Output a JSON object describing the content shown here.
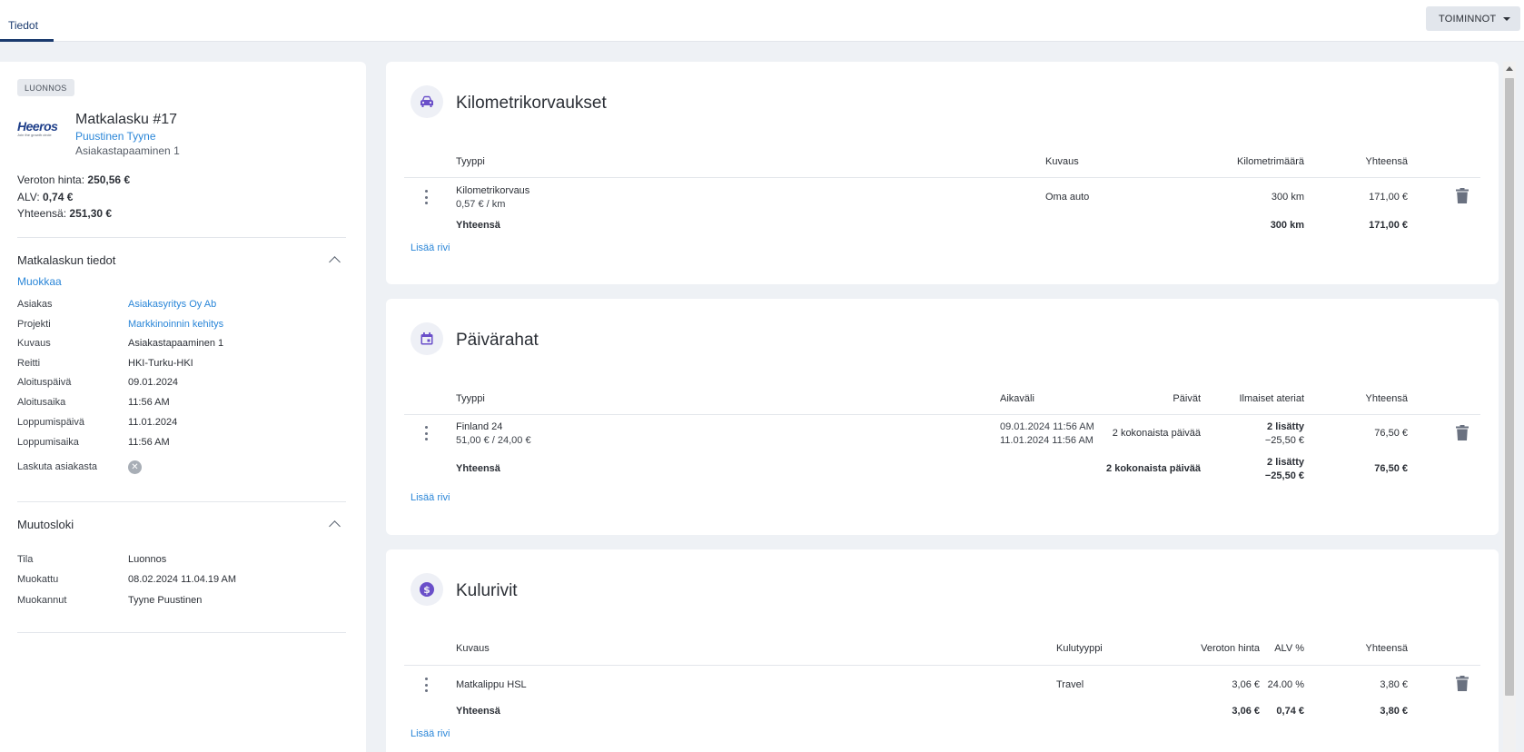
{
  "tabs": {
    "active": "Tiedot"
  },
  "actions": {
    "label": "TOIMINNOT"
  },
  "summary": {
    "status_badge": "LUONNOS",
    "logo_text": "Heeros",
    "logo_tagline": "Join the growth circle",
    "title": "Matkalasku #17",
    "person": "Puustinen Tyyne",
    "subtitle": "Asiakastapaaminen 1",
    "net_label": "Veroton hinta:",
    "net_value": "250,56 €",
    "vat_label": "ALV:",
    "vat_value": "0,74 €",
    "total_label": "Yhteensä:",
    "total_value": "251,30 €"
  },
  "details": {
    "title": "Matkalaskun tiedot",
    "edit_label": "Muokkaa",
    "rows": [
      {
        "key": "Asiakas",
        "value": "Asiakasyritys Oy Ab"
      },
      {
        "key": "Projekti",
        "value": "Markkinoinnin kehitys"
      },
      {
        "key": "Kuvaus",
        "value": "Asiakastapaaminen 1"
      },
      {
        "key": "Reitti",
        "value": "HKI-Turku-HKI"
      },
      {
        "key": "Aloituspäivä",
        "value": "09.01.2024"
      },
      {
        "key": "Aloitusaika",
        "value": "11:56 AM"
      },
      {
        "key": "Loppumispäivä",
        "value": "11.01.2024"
      },
      {
        "key": "Loppumisaika",
        "value": "11:56 AM"
      },
      {
        "key": "Laskuta asiakasta",
        "value": ""
      }
    ]
  },
  "changelog": {
    "title": "Muutosloki",
    "rows": [
      {
        "key": "Tila",
        "value": "Luonnos"
      },
      {
        "key": "Muokattu",
        "value": "08.02.2024 11.04.19 AM"
      },
      {
        "key": "Muokannut",
        "value": "Tyyne Puustinen"
      }
    ]
  },
  "mileage": {
    "title": "Kilometrikorvaukset",
    "headers": {
      "type": "Tyyppi",
      "description": "Kuvaus",
      "km": "Kilometrimäärä",
      "total": "Yhteensä"
    },
    "row": {
      "type": "Kilometrikorvaus",
      "rate": "0,57 € / km",
      "description": "Oma auto",
      "km": "300 km",
      "total": "171,00 €"
    },
    "sum": {
      "label": "Yhteensä",
      "km": "300 km",
      "total": "171,00 €"
    },
    "add_label": "Lisää rivi"
  },
  "allowances": {
    "title": "Päivärahat",
    "headers": {
      "type": "Tyyppi",
      "period": "Aikaväli",
      "days": "Päivät",
      "meals": "Ilmaiset ateriat",
      "total": "Yhteensä"
    },
    "row": {
      "type": "Finland 24",
      "rate": "51,00 € / 24,00 €",
      "start": "09.01.2024 11:56 AM",
      "end": "11.01.2024 11:56 AM",
      "days": "2 kokonaista päivää",
      "meals": "2 lisätty",
      "meals_deduction": "−25,50 €",
      "total": "76,50 €"
    },
    "sum": {
      "label": "Yhteensä",
      "days": "2 kokonaista päivää",
      "meals": "2 lisätty",
      "meals_deduction": "−25,50 €",
      "total": "76,50 €"
    },
    "add_label": "Lisää rivi"
  },
  "expenses": {
    "title": "Kulurivit",
    "headers": {
      "description": "Kuvaus",
      "type": "Kulutyyppi",
      "net": "Veroton hinta",
      "vat": "ALV %",
      "total": "Yhteensä"
    },
    "row": {
      "description": "Matkalippu HSL",
      "type": "Travel",
      "net": "3,06 €",
      "vat": "24.00 %",
      "total": "3,80 €"
    },
    "sum": {
      "label": "Yhteensä",
      "net": "3,06 €",
      "vat": "0,74 €",
      "total": "3,80 €"
    },
    "add_label": "Lisää rivi"
  },
  "colors": {
    "accent": "#1a3a6e",
    "link": "#2a86d8",
    "icon": "#6a4fc9"
  }
}
